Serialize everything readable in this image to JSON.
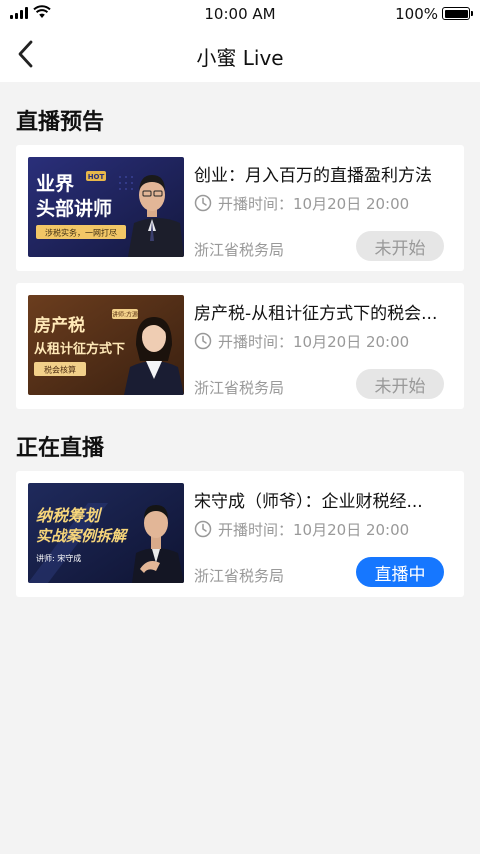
{
  "status_bar": {
    "time": "10:00 AM",
    "battery": "100%"
  },
  "nav": {
    "title": "小蜜 Live"
  },
  "sections": {
    "upcoming": {
      "title": "直播预告",
      "items": [
        {
          "title": "创业：月入百万的直播盈利方法",
          "time_label": "开播时间：",
          "time": "10月20日 20:00",
          "org": "浙江省税务局",
          "status": "未开始",
          "poster": {
            "line1": "业界",
            "line2": "头部讲师",
            "badge": "HOT",
            "tag": "涉税实务，一网打尽"
          }
        },
        {
          "title": "房产税-从租计征方式下的税会...",
          "time_label": "开播时间：",
          "time": "10月20日 20:00",
          "org": "浙江省税务局",
          "status": "未开始",
          "poster": {
            "line1": "房产税",
            "line2": "从租计征方式下",
            "badge": "讲师:方源",
            "tag": "税会核算"
          }
        }
      ]
    },
    "live": {
      "title": "正在直播",
      "items": [
        {
          "title": "宋守成（师爷）：企业财税经...",
          "time_label": "开播时间：",
          "time": "10月20日 20:00",
          "org": "浙江省税务局",
          "status": "直播中",
          "poster": {
            "line1": "纳税筹划",
            "line2": "实战案例拆解",
            "tag": "讲师: 宋守成"
          }
        }
      ]
    }
  },
  "colors": {
    "accent": "#1677ff",
    "muted": "#999999",
    "background": "#f3f3f3"
  }
}
